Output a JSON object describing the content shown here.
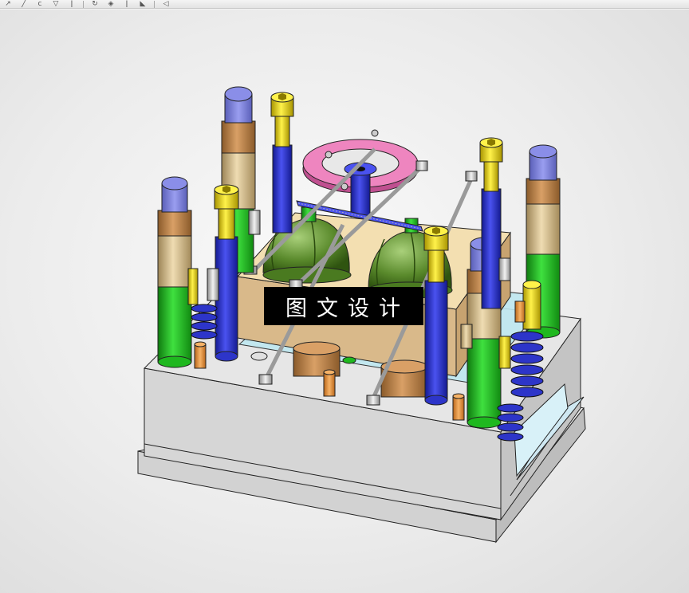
{
  "app": {
    "toolbar": {
      "buttons": [
        {
          "name": "select-tool-button",
          "icon": "arrow-icon",
          "glyph": "↗"
        },
        {
          "name": "sketch-tool-button",
          "icon": "pencil-icon",
          "glyph": "╱"
        },
        {
          "name": "curve-tool-button",
          "icon": "curve-icon",
          "glyph": "c"
        },
        {
          "name": "filter-tool-button",
          "icon": "filter-icon",
          "glyph": "▽"
        },
        {
          "name": "marker-tool-button",
          "icon": "pin-icon",
          "glyph": "ǀ"
        },
        {
          "name": "rotate-view-button",
          "icon": "rotate-icon",
          "glyph": "↻"
        },
        {
          "name": "box-view-button",
          "icon": "cube-icon",
          "glyph": "◈"
        },
        {
          "name": "measure-tool-button",
          "icon": "ruler-icon",
          "glyph": "ǀ"
        },
        {
          "name": "display-style-button",
          "icon": "shade-icon",
          "glyph": "◣"
        },
        {
          "name": "more-tools-button",
          "icon": "chevron-icon",
          "glyph": "◁"
        }
      ]
    },
    "watermark": {
      "text": "图文设计"
    },
    "colors": {
      "plate_top": "#e6e6e6",
      "plate_front": "#d0d0d0",
      "pin_green": "#1fb81f",
      "pin_tan": "#d7c193",
      "pin_blue": "#2d35c9",
      "screw_yellow": "#ecd617",
      "ring_pink": "#ee85bf",
      "dome_green": "#5a8a2c",
      "cavity_plate": "#f0d9a6"
    }
  }
}
